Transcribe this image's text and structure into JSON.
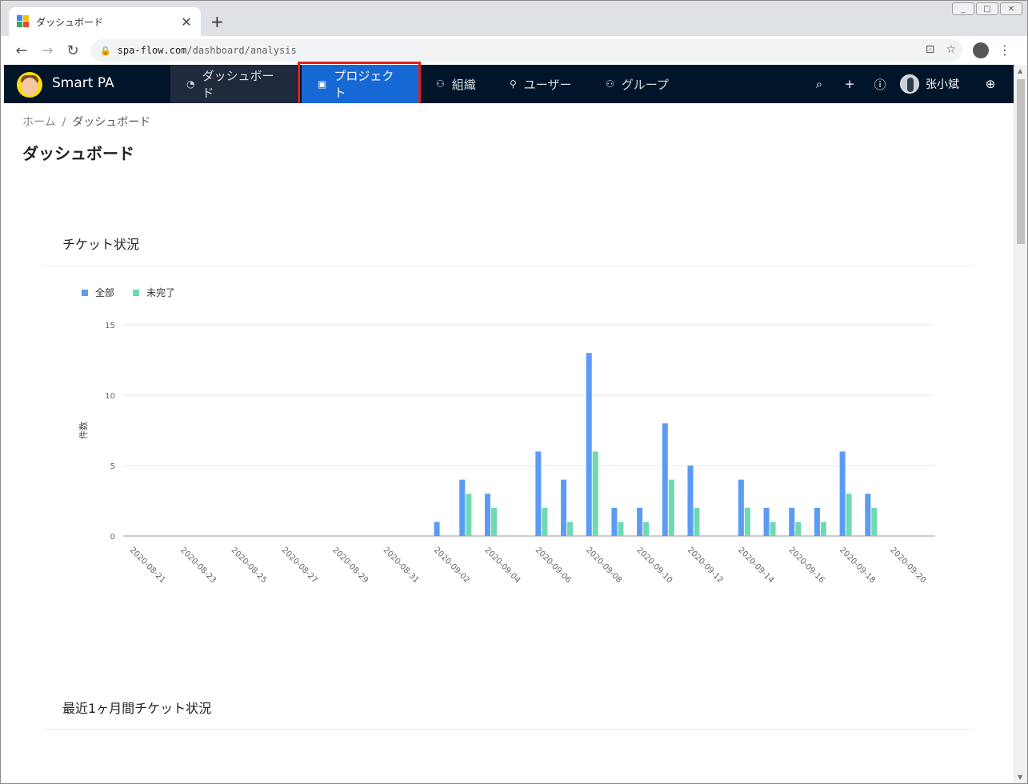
{
  "browser": {
    "tab_title": "ダッシュボード",
    "tab_close": "✕",
    "new_tab": "+",
    "url_host": "spa-flow.com",
    "url_path": "/dashboard/analysis",
    "window_controls": [
      "_",
      "□",
      "✕"
    ]
  },
  "app": {
    "name": "Smart PA",
    "nav": [
      {
        "label": "ダッシュボード",
        "icon": "gauge-icon"
      },
      {
        "label": "プロジェクト",
        "icon": "project-icon"
      },
      {
        "label": "組織",
        "icon": "team-icon"
      },
      {
        "label": "ユーザー",
        "icon": "user-icon"
      },
      {
        "label": "グループ",
        "icon": "group-icon"
      }
    ],
    "username": "张小斌",
    "active_nav": "プロジェクト"
  },
  "page": {
    "breadcrumb": [
      "ホーム",
      "ダッシュボード"
    ],
    "breadcrumb_sep": "/",
    "title": "ダッシュボード"
  },
  "cards": {
    "ticket_status": "チケット状況",
    "recent_month": "最近1ヶ月間チケット状況"
  },
  "chart_data": {
    "type": "bar",
    "title": "",
    "ylabel": "件数",
    "xlabel": "",
    "ylim": [
      0,
      15
    ],
    "yticks": [
      0,
      5,
      10,
      15
    ],
    "legend_position": "top-left",
    "grid": true,
    "categories": [
      "2020-08-21",
      "2020-08-22",
      "2020-08-23",
      "2020-08-24",
      "2020-08-25",
      "2020-08-26",
      "2020-08-27",
      "2020-08-28",
      "2020-08-29",
      "2020-08-30",
      "2020-08-31",
      "2020-09-01",
      "2020-09-02",
      "2020-09-03",
      "2020-09-04",
      "2020-09-05",
      "2020-09-06",
      "2020-09-07",
      "2020-09-08",
      "2020-09-09",
      "2020-09-10",
      "2020-09-11",
      "2020-09-12",
      "2020-09-13",
      "2020-09-14",
      "2020-09-15",
      "2020-09-16",
      "2020-09-17",
      "2020-09-18",
      "2020-09-19",
      "2020-09-20",
      "2020-09-21"
    ],
    "tick_labels": [
      "2020-08-21",
      "2020-08-23",
      "2020-08-25",
      "2020-08-27",
      "2020-08-29",
      "2020-08-31",
      "2020-09-02",
      "2020-09-04",
      "2020-09-06",
      "2020-09-08",
      "2020-09-10",
      "2020-09-12",
      "2020-09-14",
      "2020-09-16",
      "2020-09-18",
      "2020-09-20"
    ],
    "series": [
      {
        "name": "全部",
        "color": "#5b9bf5",
        "values": [
          0,
          0,
          0,
          0,
          0,
          0,
          0,
          0,
          0,
          0,
          0,
          0,
          1,
          4,
          3,
          0,
          6,
          4,
          13,
          2,
          2,
          8,
          5,
          0,
          4,
          2,
          2,
          2,
          6,
          3,
          0,
          0
        ]
      },
      {
        "name": "未完了",
        "color": "#6fd9b0",
        "values": [
          0,
          0,
          0,
          0,
          0,
          0,
          0,
          0,
          0,
          0,
          0,
          0,
          0,
          3,
          2,
          0,
          2,
          1,
          6,
          1,
          1,
          4,
          2,
          0,
          2,
          1,
          1,
          1,
          3,
          2,
          0,
          0
        ]
      }
    ]
  }
}
